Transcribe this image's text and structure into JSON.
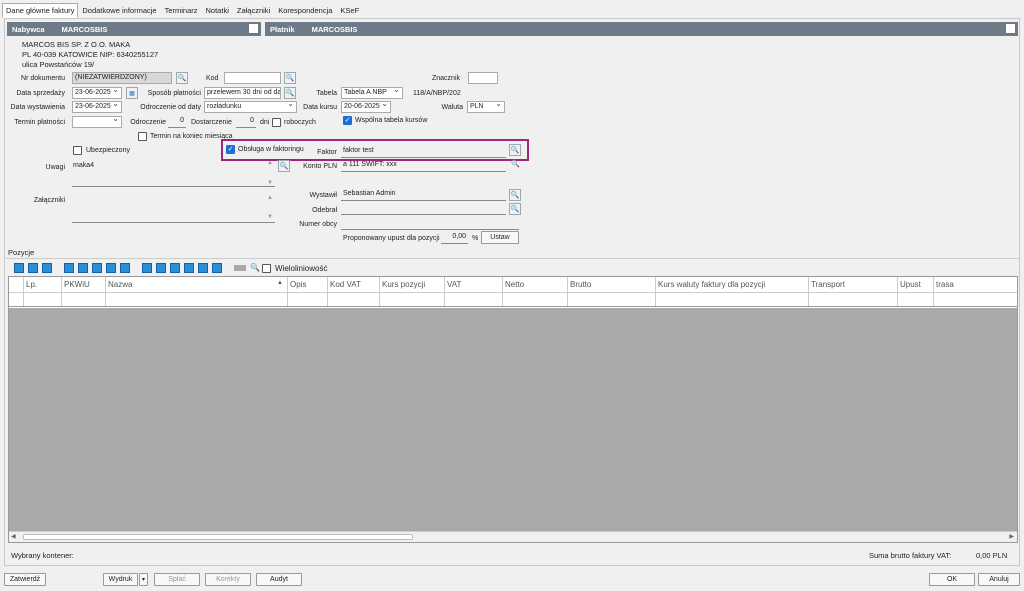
{
  "tabs": [
    "Dane główne faktury",
    "Dodatkowe informacje",
    "Terminarz",
    "Notatki",
    "Załączniki",
    "Korespondencja",
    "KSeF"
  ],
  "buyer": {
    "header_key": "Nabywca",
    "header_val": "MARCOSBIS",
    "line1": "MARCOS BIS SP. Z O.O. MAKA",
    "line2": "PL 40-039 KATOWICE NIP: 6340255127",
    "line3": "ulica Powstańców 19/"
  },
  "payer": {
    "header_key": "Płatnik",
    "header_val": "MARCOSBIS"
  },
  "form": {
    "nr_dok_label": "Nr dokumentu",
    "nr_dok_value": "(NIEZATWIERDZONY)",
    "kod_label": "Kod",
    "kod_value": "",
    "znacznik_label": "Znacznik",
    "znacznik_value": "",
    "data_sprz_label": "Data sprzedaży",
    "data_sprz_value": "23-06-2025",
    "sposob_label": "Sposób płatności",
    "sposob_value": "przelewem 30 dni od dat",
    "tabela_label": "Tabela",
    "tabela_value": "Tabela A NBP",
    "tabela_nr": "118/A/NBP/202",
    "data_wyst_label": "Data wystawienia",
    "data_wyst_value": "23-06-2025",
    "odrocz_od_label": "Odroczenie od daty",
    "odrocz_od_value": "rozładunku",
    "data_kursu_label": "Data kursu",
    "data_kursu_value": "20-06-2025",
    "waluta_label": "Waluta",
    "waluta_value": "PLN",
    "termin_label": "Termin płatności",
    "termin_value": "",
    "odroczenie_label": "Odroczenie",
    "odroczenie_value": "0",
    "dostarczenie_label": "Dostarczenie",
    "dostarczenie_value": "0",
    "dni_label": "dni",
    "roboczych_label": "roboczych",
    "wspolna_label": "Wspólna tabela kursów",
    "koniec_label": "Termin na koniec miesiąca",
    "ubezp_label": "Ubezpieczony",
    "faktoring_label": "Obsługa w faktoringu",
    "faktor_label": "Faktor",
    "faktor_value": "faktor test",
    "konto_label": "Konto PLN",
    "konto_value": "a 111 SWIFT: xxx",
    "uwagi_label": "Uwagi",
    "uwagi_value": "maka4",
    "zalaczniki_label": "Załączniki",
    "wystawil_label": "Wystawił",
    "wystawil_value": "Sebastian Admin",
    "odebral_label": "Odebrał",
    "odebral_value": "",
    "numer_obcy_label": "Numer obcy",
    "numer_obcy_value": "",
    "upust_label": "Proponowany upust dla pozycji",
    "upust_value": "0,00",
    "upust_unit": "%",
    "ustaw_label": "Ustaw"
  },
  "positions": {
    "tab_label": "Pozycje",
    "wieloliniowosc": "Wieloliniowość",
    "columns": [
      "Lp.",
      "PKWiU",
      "Nazwa",
      "Opis",
      "Kod VAT",
      "Kurs pozycji",
      "VAT",
      "Netto",
      "Brutto",
      "Kurs waluty faktury dla pozycji",
      "Transport",
      "Upust",
      "trasa"
    ]
  },
  "status": {
    "kontener_label": "Wybrany kontener:",
    "suma_label": "Suma brutto faktury VAT:",
    "suma_value": "0,00 PLN"
  },
  "footer": {
    "zatwierdz": "Zatwierdź",
    "wydruk": "Wydruk",
    "splac": "Spłać",
    "korekty": "Korekty",
    "audyt": "Audyt",
    "ok": "OK",
    "anuluj": "Anuluj"
  },
  "colors": {
    "header_bar": "#6e7a88",
    "highlight_border": "#a0257e",
    "checkbox_on": "#1a6fd8"
  }
}
